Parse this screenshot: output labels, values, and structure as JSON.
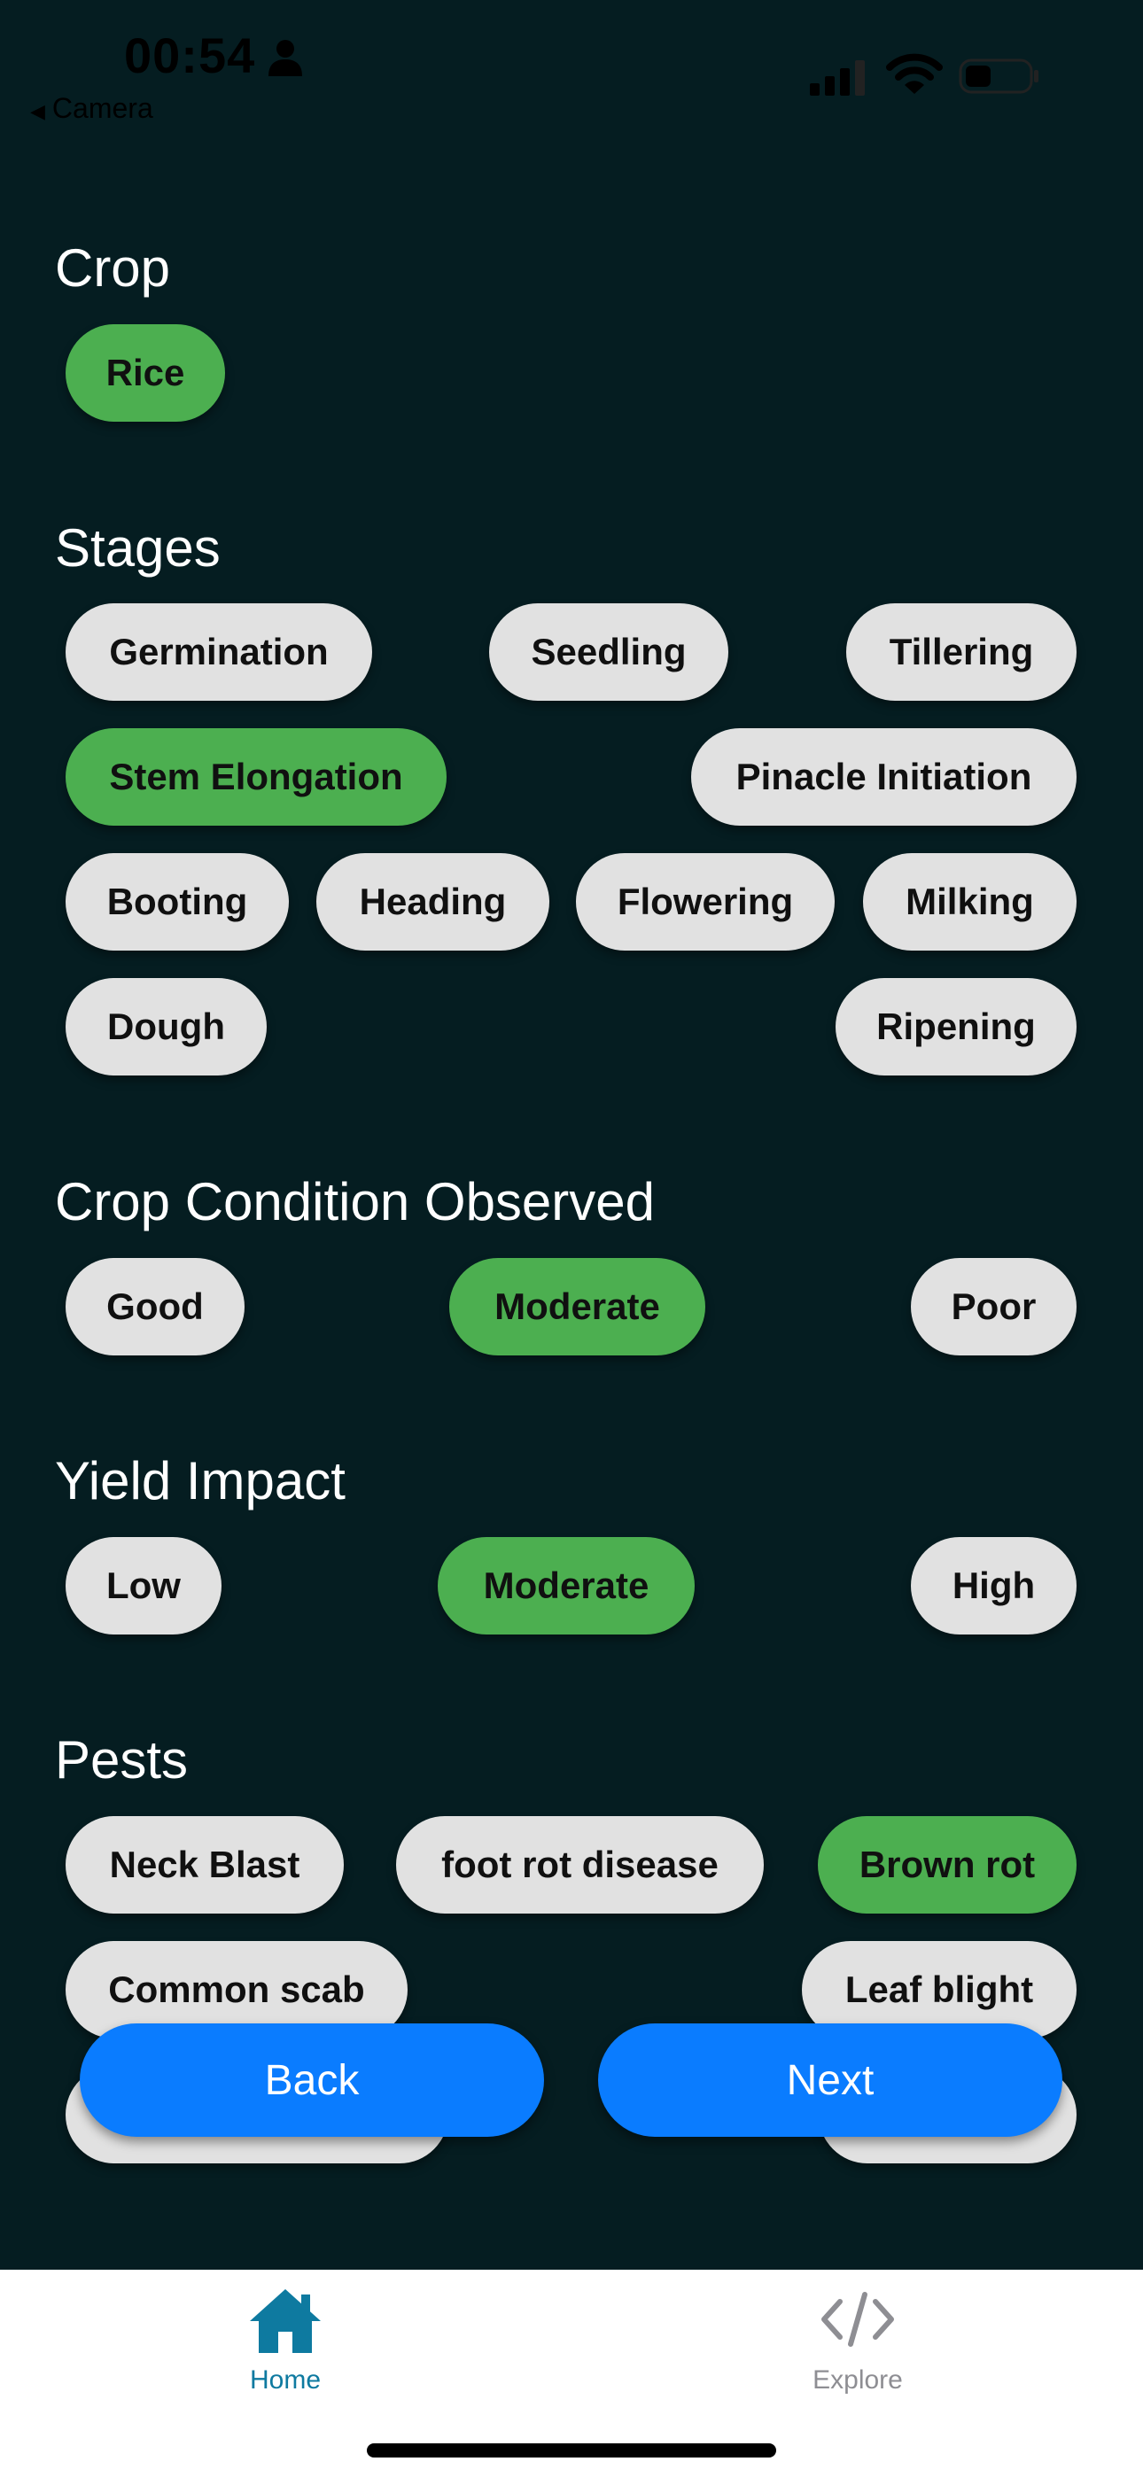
{
  "status_bar": {
    "time": "00:54",
    "back_label": "Camera"
  },
  "sections": {
    "crop": {
      "title": "Crop",
      "options": [
        "Rice"
      ]
    },
    "stages": {
      "title": "Stages",
      "options": [
        "Germination",
        "Seedling",
        "Tillering",
        "Stem Elongation",
        "Pinacle Initiation",
        "Booting",
        "Heading",
        "Flowering",
        "Milking",
        "Dough",
        "Ripening"
      ]
    },
    "condition": {
      "title": "Crop Condition Observed",
      "options": [
        "Good",
        "Moderate",
        "Poor"
      ]
    },
    "yield": {
      "title": "Yield Impact",
      "options": [
        "Low",
        "Moderate",
        "High"
      ]
    },
    "pests": {
      "title": "Pests",
      "options": [
        "Neck Blast",
        "foot rot disease",
        "Brown rot",
        "Common scab",
        "Leaf blight"
      ]
    }
  },
  "selected": {
    "crop": "Rice",
    "stage": "Stem Elongation",
    "condition": "Moderate",
    "yield": "Moderate",
    "pest": "Brown rot"
  },
  "buttons": {
    "back": "Back",
    "next": "Next"
  },
  "tabs": [
    {
      "label": "Home",
      "icon": "home-icon",
      "active": true
    },
    {
      "label": "Explore",
      "icon": "code-icon",
      "active": false
    }
  ],
  "colors": {
    "background": "#051d21",
    "chip": "#e1e1e1",
    "chip_selected": "#4caf50",
    "button": "#0a7cff",
    "tab_active": "#0e7aa0",
    "tab_inactive": "#8e8e93"
  }
}
